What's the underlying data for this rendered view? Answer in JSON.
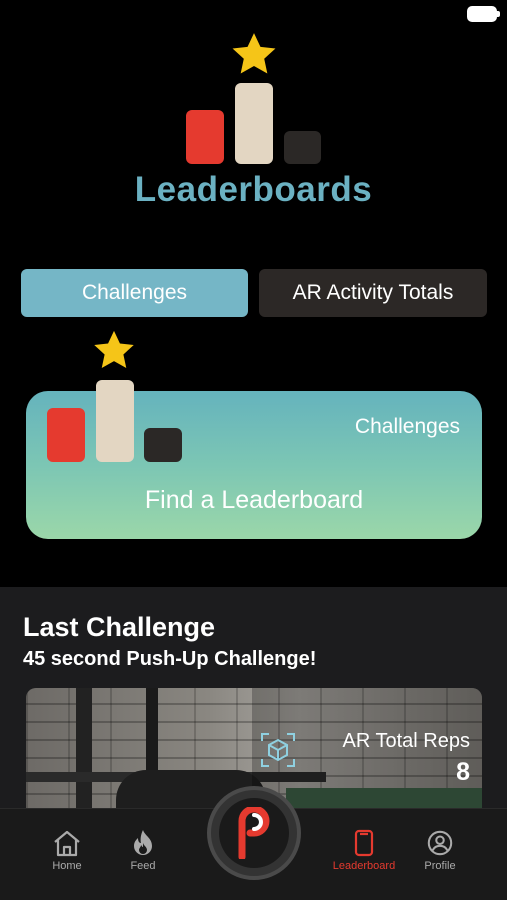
{
  "header": {
    "title": "Leaderboards"
  },
  "tabs": [
    {
      "label": "Challenges",
      "active": true
    },
    {
      "label": "AR Activity Totals",
      "active": false
    }
  ],
  "card": {
    "category": "Challenges",
    "action": "Find a Leaderboard"
  },
  "last_challenge": {
    "title": "Last Challenge",
    "subtitle": "45 second Push-Up Challenge!",
    "stat_label": "AR Total Reps",
    "stat_value": "8"
  },
  "nav": {
    "items": [
      {
        "label": "Home",
        "icon": "home-icon"
      },
      {
        "label": "Feed",
        "icon": "flame-icon"
      },
      {
        "label": "Leaderboard",
        "icon": "leaderboard-icon",
        "active": true
      },
      {
        "label": "Profile",
        "icon": "profile-icon"
      }
    ],
    "center_icon": "app-logo-icon"
  },
  "colors": {
    "accent_red": "#e53a2f",
    "accent_teal": "#6bb1c2",
    "beige": "#e3d6c2",
    "star": "#f5c518"
  }
}
